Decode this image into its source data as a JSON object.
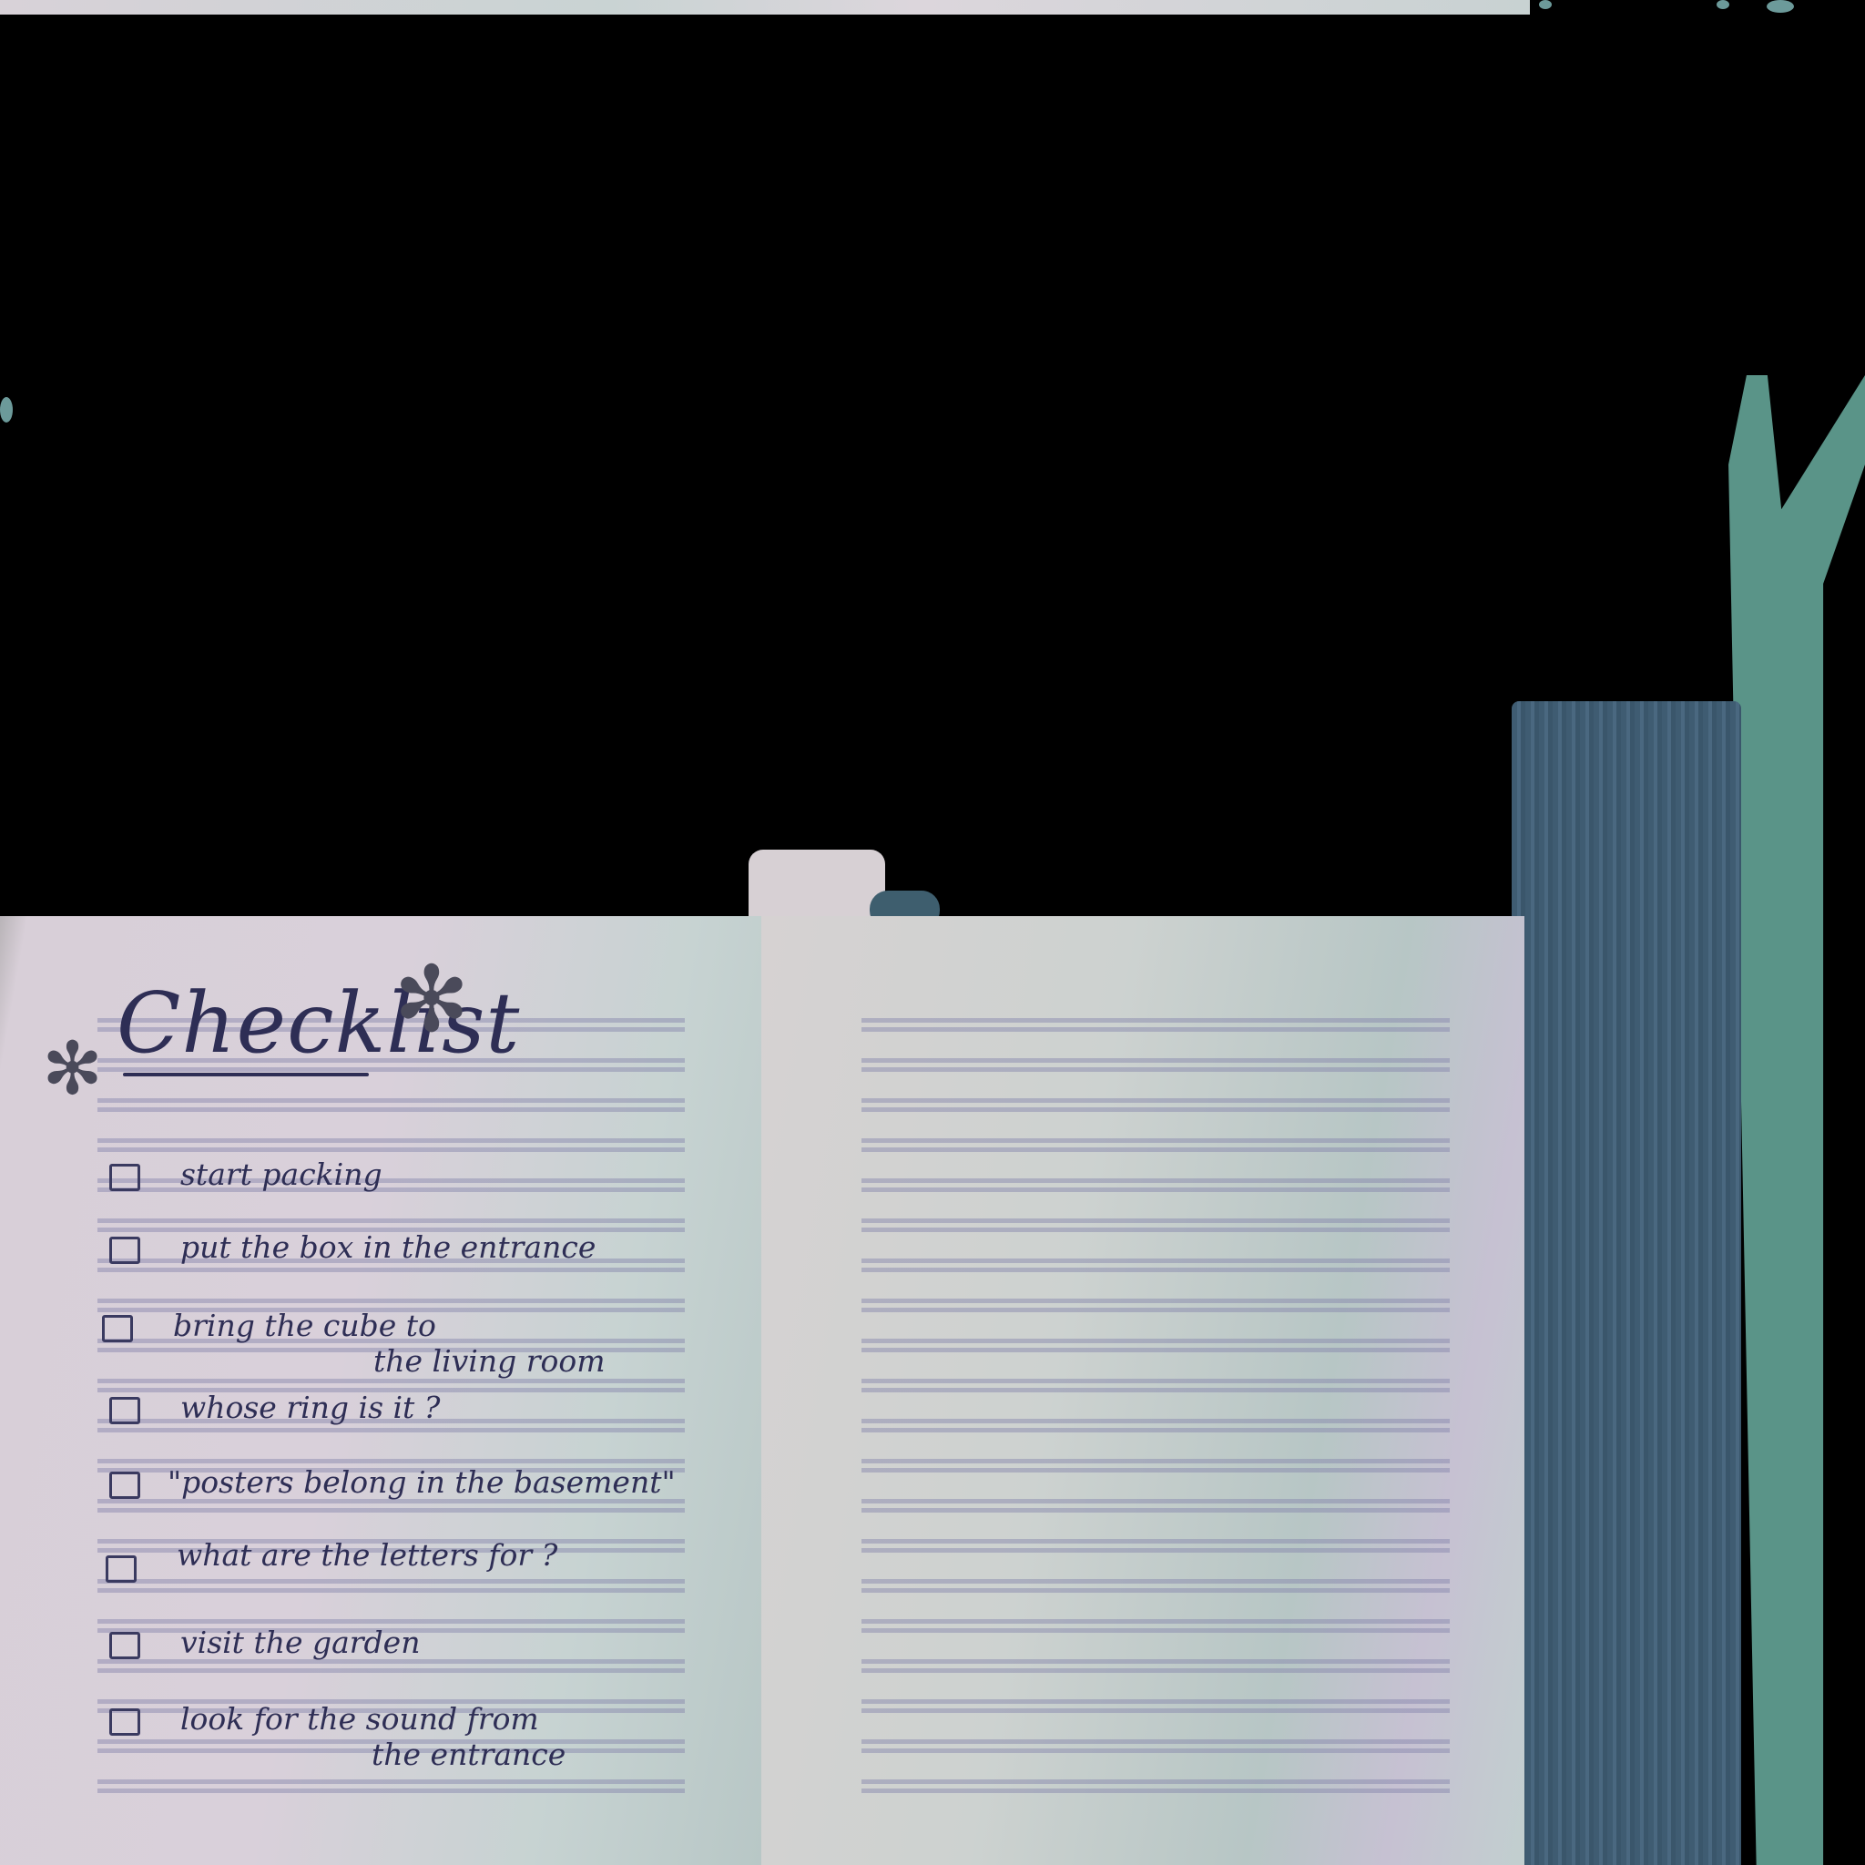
{
  "checklist": {
    "title": "Checklist",
    "items": [
      {
        "line1": "start packing",
        "line2": ""
      },
      {
        "line1": "put the box in the entrance",
        "line2": ""
      },
      {
        "line1": "bring the cube to",
        "line2": "the living room"
      },
      {
        "line1": "whose ring is it ?",
        "line2": ""
      },
      {
        "line1": "\"posters belong in the basement\"",
        "line2": ""
      },
      {
        "line1": "what are the letters for ?",
        "line2": ""
      },
      {
        "line1": "visit the garden",
        "line2": ""
      },
      {
        "line1": "look for the sound from",
        "line2": "the entrance"
      }
    ]
  },
  "colors": {
    "ink": "#2e2e55",
    "spine": "#3f5c72",
    "green": "#5a9488"
  }
}
